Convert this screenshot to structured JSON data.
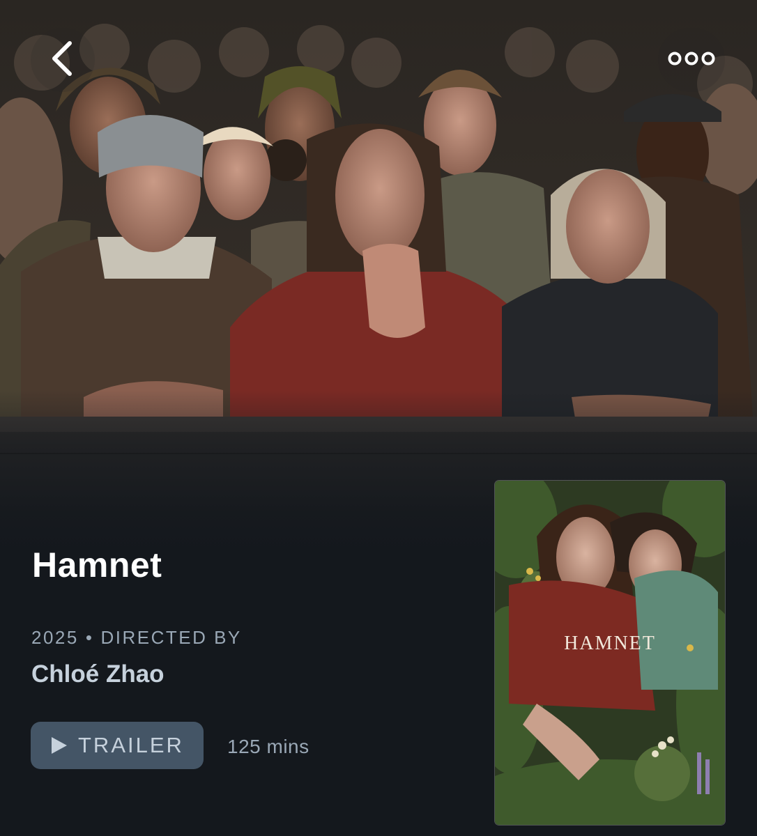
{
  "header": {
    "back_icon": "chevron-left-icon",
    "more_icon": "ellipsis-icon"
  },
  "film": {
    "title": "Hamnet",
    "year": "2025",
    "separator": "•",
    "directed_by_label": "DIRECTED BY",
    "director": "Chloé Zhao",
    "trailer_label": "TRAILER",
    "runtime": "125 mins",
    "poster_title": "HAMNET"
  },
  "colors": {
    "background": "#14181d",
    "title": "#ffffff",
    "secondary_text": "#9aa8b6",
    "director_text": "#c6d1dc",
    "trailer_button": "#445566"
  }
}
